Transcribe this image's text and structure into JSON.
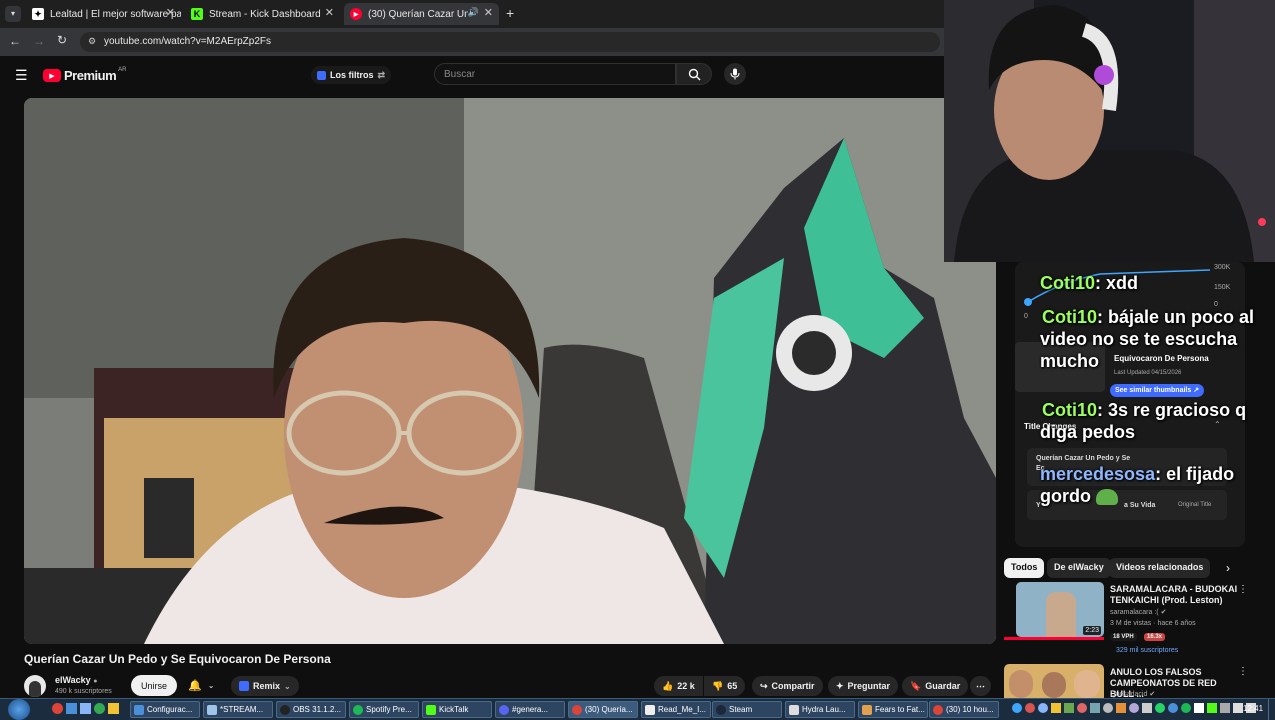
{
  "browser": {
    "tabs": [
      {
        "title": "Lealtad | El mejor software par",
        "active": false
      },
      {
        "title": "Stream - Kick Dashboard",
        "active": false
      },
      {
        "title": "(30) Querían Cazar Un Pedo",
        "active": true
      }
    ],
    "url": "youtube.com/watch?v=M2AErpZp2Fs"
  },
  "youtube": {
    "logo": "Premium",
    "logo_sup": "AR",
    "filters_label": "Los filtros",
    "search_placeholder": "Buscar"
  },
  "video": {
    "title": "Querían Cazar Un Pedo y Se Equivocaron De Persona",
    "channel": "elWacky",
    "subscribers": "490 k suscriptores",
    "join_label": "Unirse",
    "remix_label": "Remix",
    "likes": "22 k",
    "dislikes": "65",
    "share_label": "Compartir",
    "ask_label": "Preguntar",
    "save_label": "Guardar"
  },
  "overlay_panel": {
    "axis_300k": "300K",
    "axis_150k": "150K",
    "axis_0": "0",
    "axis_left_0": "0",
    "title": "Equivocaron De Persona",
    "last_updated": "Last Updated 04/15/2026",
    "similar_btn": "See similar thumbnails ↗",
    "section": "Title Changes",
    "change_1": "Querían Cazar Un Pedo y Se",
    "change_1b": "Ec",
    "change_2_pre": "Y",
    "change_2_post": "a Su Vida",
    "original": "Original Title"
  },
  "chat": [
    {
      "user": "Coti10",
      "msg": ": xdd"
    },
    {
      "user": "Coti10",
      "msg": ": bájale un poco al video no se te escucha mucho"
    },
    {
      "user": "Coti10",
      "msg": ": 3s re gracioso q diga pedos"
    },
    {
      "user": "mercedesosa",
      "msg": ": el fijado gordo"
    }
  ],
  "chips": [
    "Todos",
    "De elWacky",
    "Videos relacionados"
  ],
  "recommendations": [
    {
      "title": "SARAMALACARA - BUDOKAI TENKAICHI (Prod. Leston)",
      "channel": "saramalacara :(",
      "meta": "3 M de vistas · hace 6 años",
      "duration": "2:23",
      "vph": "18 VPH",
      "ratio": "16.3x",
      "subs": "329 mil suscriptores"
    },
    {
      "title": "ANULO LOS FALSOS CAMPEONATOS DE RED BULL ...",
      "channel": "Quesadacid",
      "meta": "",
      "duration": "",
      "vph": "",
      "ratio": "",
      "subs": ""
    }
  ],
  "taskbar": {
    "items": [
      "Configurac...",
      "*STREAM...",
      "OBS 31.1.2...",
      "Spotify Pre...",
      "KickTalk",
      "#genera...",
      "(30) Quería...",
      "Read_Me_I...",
      "Steam",
      "Hydra Lau...",
      "Fears to Fat...",
      "(30) 10 hou..."
    ],
    "clock": "12:41"
  },
  "colors": {
    "yt_red": "#ff0033",
    "kick_green": "#53fc18",
    "chat_user": "#9cff5f",
    "accent_blue": "#3ea6ff"
  }
}
